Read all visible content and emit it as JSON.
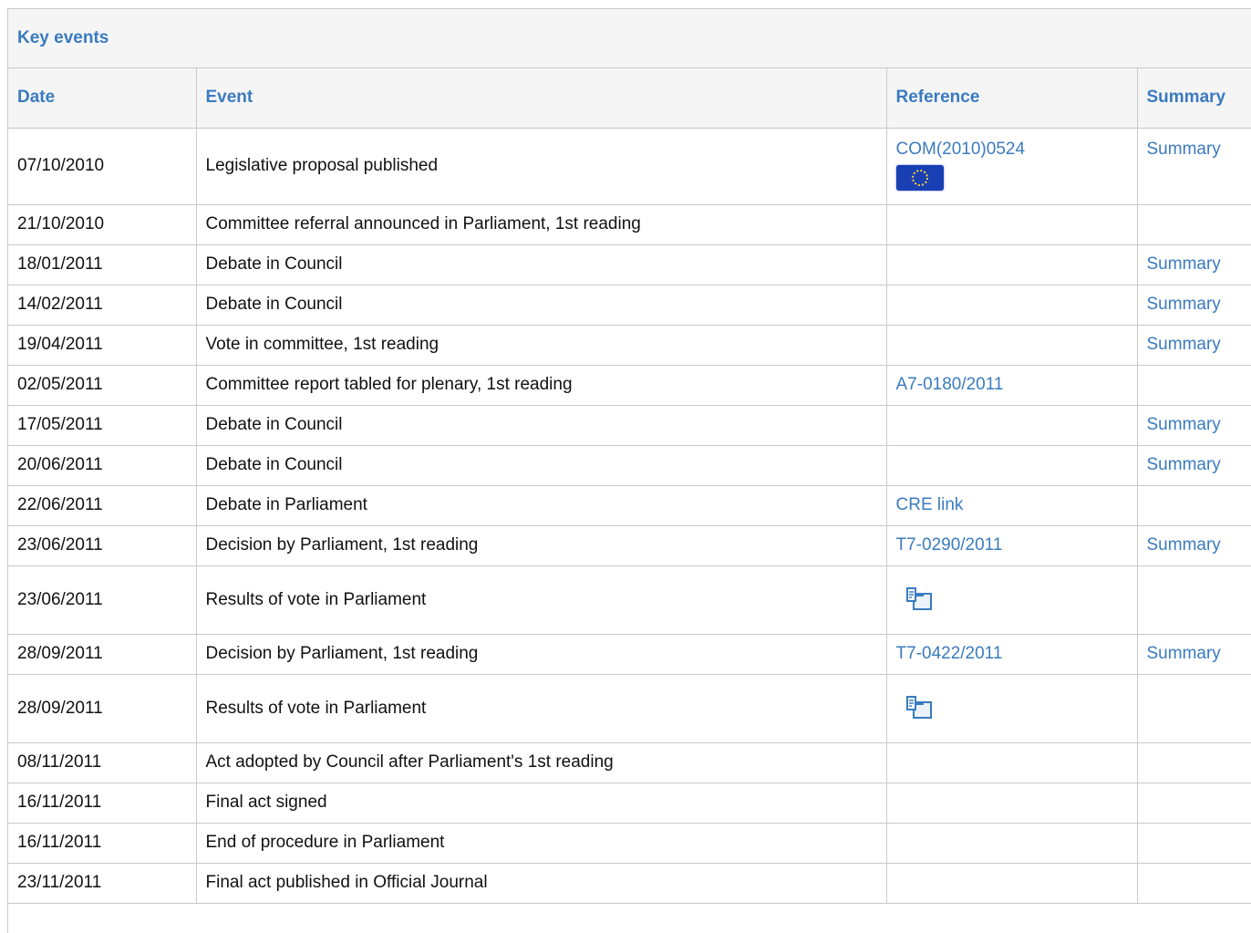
{
  "panel": {
    "title": "Key events"
  },
  "columns": {
    "date": "Date",
    "event": "Event",
    "reference": "Reference",
    "summary": "Summary"
  },
  "icons": {
    "flag": "eu-flag-icon",
    "vote": "vote-results-icon"
  },
  "colors": {
    "link": "#3a7bbf",
    "header_bg": "#f5f5f5",
    "border": "#c8c8c8"
  },
  "rows": [
    {
      "date": "07/10/2010",
      "event": "Legislative proposal published",
      "reference": "COM(2010)0524",
      "summary": "Summary"
    },
    {
      "date": "21/10/2010",
      "event": "Committee referral announced in Parliament, 1st reading",
      "reference": "",
      "summary": ""
    },
    {
      "date": "18/01/2011",
      "event": "Debate in Council",
      "reference": "",
      "summary": "Summary"
    },
    {
      "date": "14/02/2011",
      "event": "Debate in Council",
      "reference": "",
      "summary": "Summary"
    },
    {
      "date": "19/04/2011",
      "event": "Vote in committee, 1st reading",
      "reference": "",
      "summary": "Summary"
    },
    {
      "date": "02/05/2011",
      "event": "Committee report tabled for plenary, 1st reading",
      "reference": "A7-0180/2011",
      "summary": ""
    },
    {
      "date": "17/05/2011",
      "event": "Debate in Council",
      "reference": "",
      "summary": "Summary"
    },
    {
      "date": "20/06/2011",
      "event": "Debate in Council",
      "reference": "",
      "summary": "Summary"
    },
    {
      "date": "22/06/2011",
      "event": "Debate in Parliament",
      "reference": "CRE link",
      "summary": ""
    },
    {
      "date": "23/06/2011",
      "event": "Decision by Parliament, 1st reading",
      "reference": "T7-0290/2011",
      "summary": "Summary"
    },
    {
      "date": "23/06/2011",
      "event": "Results of vote in Parliament",
      "reference": "",
      "summary": ""
    },
    {
      "date": "28/09/2011",
      "event": "Decision by Parliament, 1st reading",
      "reference": "T7-0422/2011",
      "summary": "Summary"
    },
    {
      "date": "28/09/2011",
      "event": "Results of vote in Parliament",
      "reference": "",
      "summary": ""
    },
    {
      "date": "08/11/2011",
      "event": "Act adopted by Council after Parliament's 1st reading",
      "reference": "",
      "summary": ""
    },
    {
      "date": "16/11/2011",
      "event": "Final act signed",
      "reference": "",
      "summary": ""
    },
    {
      "date": "16/11/2011",
      "event": "End of procedure in Parliament",
      "reference": "",
      "summary": ""
    },
    {
      "date": "23/11/2011",
      "event": "Final act published in Official Journal",
      "reference": "",
      "summary": ""
    }
  ]
}
